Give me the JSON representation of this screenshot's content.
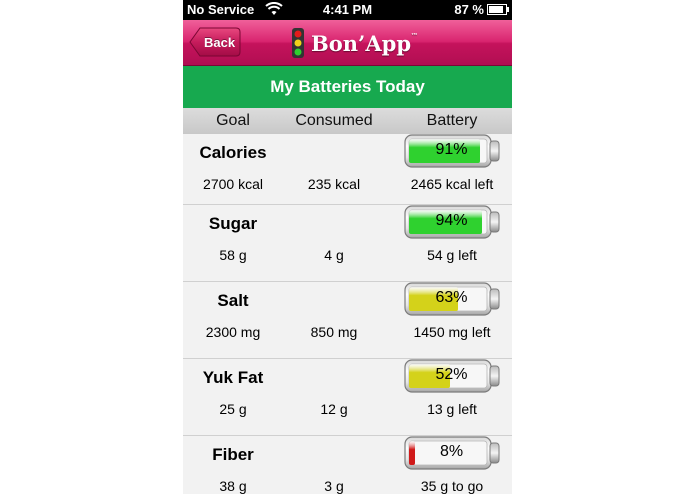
{
  "status_bar": {
    "carrier": "No Service",
    "time": "4:41 PM",
    "battery": "87 %"
  },
  "nav": {
    "back_label": "Back",
    "logo_text": "Bon’App",
    "logo_tm": "™"
  },
  "title": "My Batteries Today",
  "headers": {
    "goal": "Goal",
    "consumed": "Consumed",
    "battery": "Battery"
  },
  "rows": [
    {
      "name": "Calories",
      "goal": "2700 kcal",
      "consumed": "235 kcal",
      "left": "2465 kcal left",
      "percent_label": "91%",
      "percent": 91,
      "color": "#2fd12f"
    },
    {
      "name": "Sugar",
      "goal": "58 g",
      "consumed": "4 g",
      "left": "54 g left",
      "percent_label": "94%",
      "percent": 94,
      "color": "#2fd12f"
    },
    {
      "name": "Salt",
      "goal": "2300 mg",
      "consumed": "850 mg",
      "left": "1450 mg left",
      "percent_label": "63%",
      "percent": 63,
      "color": "#d4d21a"
    },
    {
      "name": "Yuk Fat",
      "goal": "25 g",
      "consumed": "12 g",
      "left": "13 g left",
      "percent_label": "52%",
      "percent": 52,
      "color": "#d4d21a"
    },
    {
      "name": "Fiber",
      "goal": "38 g",
      "consumed": "3 g",
      "left": "35 g to go",
      "percent_label": "8%",
      "percent": 8,
      "color": "#d01a1a"
    }
  ]
}
